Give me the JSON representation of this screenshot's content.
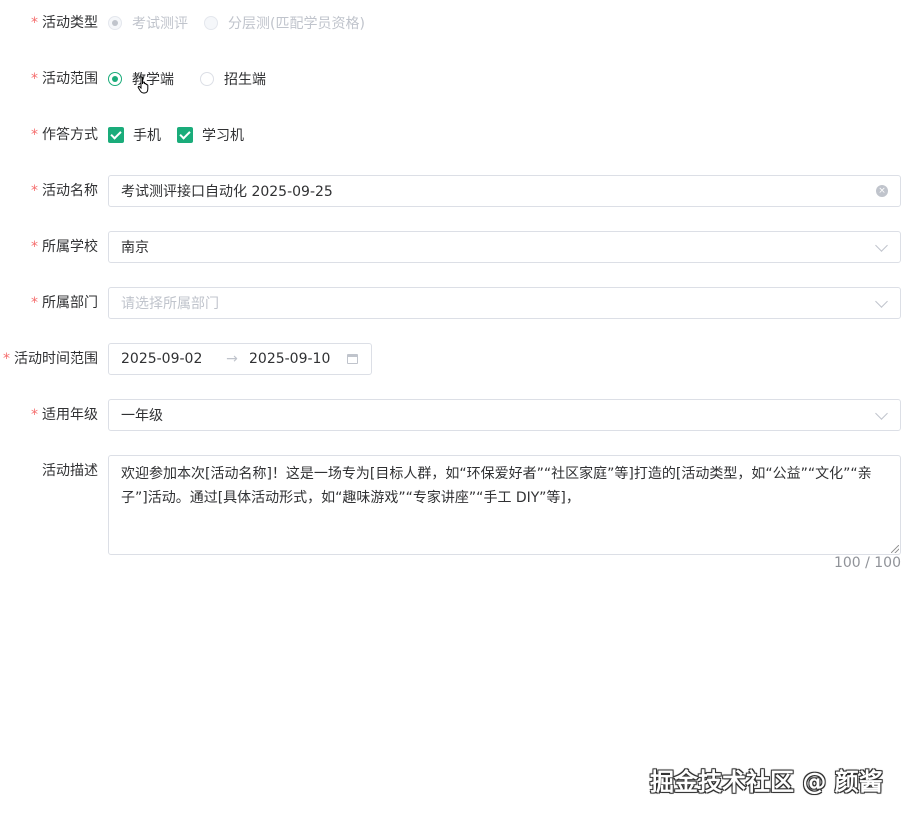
{
  "form": {
    "activity_type": {
      "label": "活动类型",
      "options": [
        {
          "label": "考试测评",
          "checked": true,
          "disabled": true
        },
        {
          "label": "分层测(匹配学员资格)",
          "checked": false,
          "disabled": true
        }
      ]
    },
    "activity_scope": {
      "label": "活动范围",
      "options": [
        {
          "label": "教学端",
          "checked": true
        },
        {
          "label": "招生端",
          "checked": false
        }
      ]
    },
    "answer_mode": {
      "label": "作答方式",
      "options": [
        {
          "label": "手机",
          "checked": true
        },
        {
          "label": "学习机",
          "checked": true
        }
      ]
    },
    "activity_name": {
      "label": "活动名称",
      "value": "考试测评接口自动化 2025-09-25"
    },
    "school": {
      "label": "所属学校",
      "value": "南京"
    },
    "department": {
      "label": "所属部门",
      "placeholder": "请选择所属部门"
    },
    "time_range": {
      "label": "活动时间范围",
      "start": "2025-09-02",
      "separator": "→",
      "end": "2025-09-10"
    },
    "grade": {
      "label": "适用年级",
      "value": "一年级"
    },
    "description": {
      "label": "活动描述",
      "value": "欢迎参加本次[活动名称]！这是一场专为[目标人群，如“环保爱好者”“社区家庭”等]打造的[活动类型，如“公益”“文化”“亲子”]活动。通过[具体活动形式，如“趣味游戏”“专家讲座”“手工 DIY”等]，",
      "count": "100 / 100"
    }
  },
  "required_mark": "*",
  "watermark": "掘金技术社区 @ 颜酱",
  "colors": {
    "accent": "#1aac7a",
    "required": "#f56c6c"
  }
}
